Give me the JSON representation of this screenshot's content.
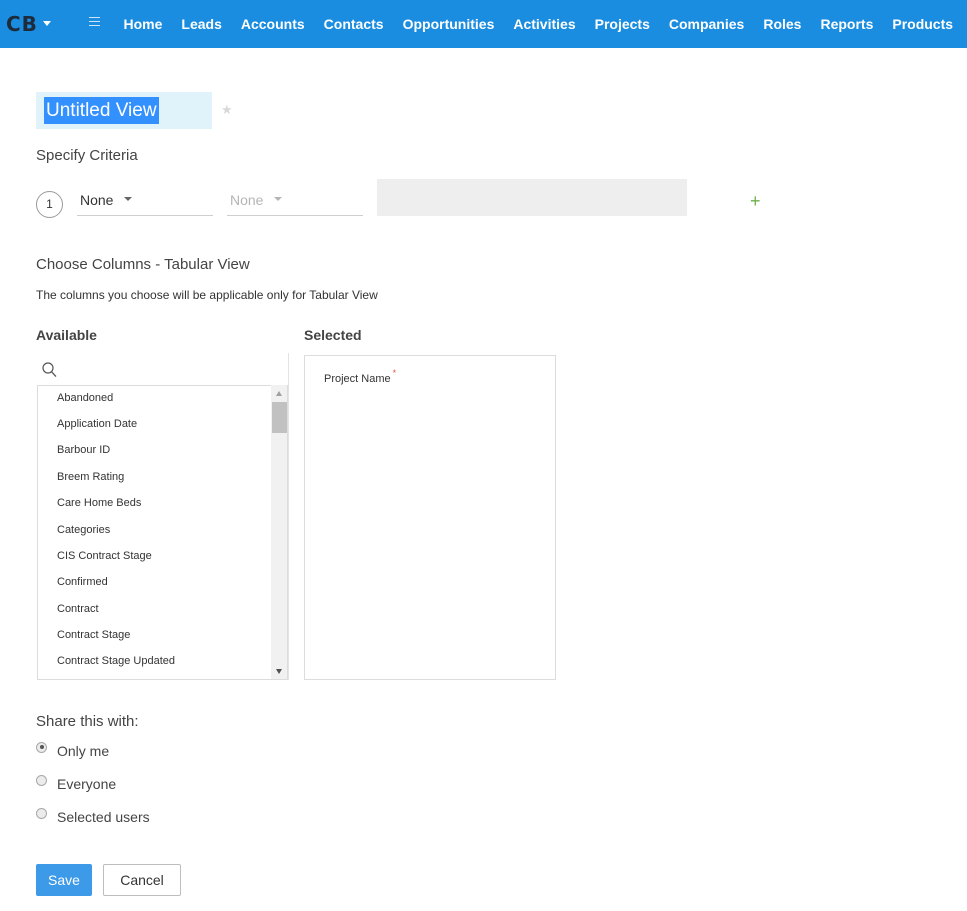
{
  "nav": {
    "logo": "CB",
    "items": [
      "Home",
      "Leads",
      "Accounts",
      "Contacts",
      "Opportunities",
      "Activities",
      "Projects",
      "Companies",
      "Roles",
      "Reports",
      "Products"
    ]
  },
  "view": {
    "title": "Untitled View",
    "favorite_icon": "star-icon"
  },
  "criteria": {
    "heading": "Specify Criteria",
    "row_number": "1",
    "field": "None",
    "operator": "None",
    "value": "",
    "add_icon": "plus-icon"
  },
  "columns": {
    "heading": "Choose Columns - Tabular View",
    "note": "The columns you choose will be applicable only for Tabular View",
    "available_label": "Available",
    "selected_label": "Selected",
    "available": [
      "Abandoned",
      "Application Date",
      "Barbour ID",
      "Breem Rating",
      "Care Home Beds",
      "Categories",
      "CIS Contract Stage",
      "Confirmed",
      "Contract",
      "Contract Stage",
      "Contract Stage Updated"
    ],
    "selected": [
      "Project Name"
    ],
    "required_mark": "*"
  },
  "share": {
    "heading": "Share this with:",
    "options": [
      "Only me",
      "Everyone",
      "Selected users"
    ],
    "selected": "Only me"
  },
  "actions": {
    "save": "Save",
    "cancel": "Cancel"
  },
  "colors": {
    "nav_bg": "#1a8de0",
    "save_bg": "#3d9ae8",
    "title_highlight": "#3390ff",
    "add_icon": "#6ab04c"
  }
}
